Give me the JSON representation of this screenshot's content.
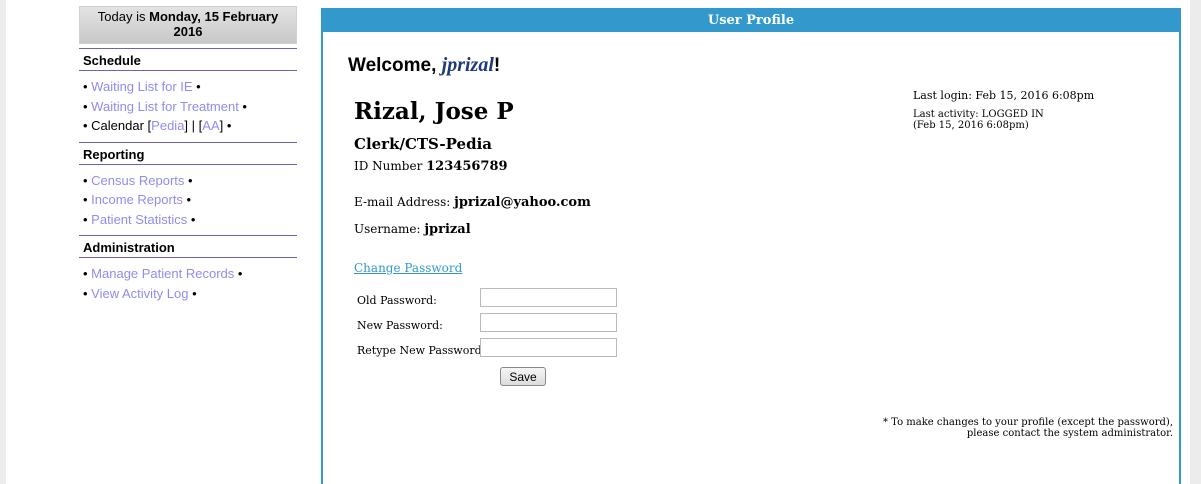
{
  "sidebar": {
    "today_prefix": "Today is ",
    "today_date": "Monday, 15 February 2016",
    "sections": [
      {
        "title": "Schedule",
        "items": [
          {
            "link": "Waiting List for IE",
            "suffix": " •"
          },
          {
            "link": "Waiting List for Treatment",
            "suffix": " •"
          }
        ],
        "calendar": {
          "prefix": "Calendar ",
          "link1": "Pedia",
          "sep": " | ",
          "link2": "AA",
          "suffix": " •"
        }
      },
      {
        "title": "Reporting",
        "items": [
          {
            "link": "Census Reports",
            "suffix": " •"
          },
          {
            "link": "Income Reports",
            "suffix": " •"
          },
          {
            "link": "Patient Statistics",
            "suffix": " •"
          }
        ]
      },
      {
        "title": "Administration",
        "items": [
          {
            "link": "Manage Patient Records",
            "suffix": " •"
          },
          {
            "link": "View Activity Log",
            "suffix": " •"
          }
        ]
      }
    ]
  },
  "panel": {
    "header": "User Profile",
    "welcome_prefix": "Welcome, ",
    "welcome_user": "jprizal",
    "welcome_suffix": "!",
    "full_name": "Rizal, Jose P",
    "role": "Clerk/CTS-Pedia",
    "id_label": "ID Number",
    "id_value": "123456789",
    "email_label": "E-mail Address:",
    "email_value": "jprizal@yahoo.com",
    "username_label": "Username:",
    "username_value": "jprizal",
    "last_login": "Last login: Feb 15, 2016 6:08pm",
    "last_activity_line1": "Last activity: LOGGED IN",
    "last_activity_line2": "(Feb 15, 2016 6:08pm)",
    "change_password_link": "Change Password",
    "password_form": {
      "old_label": "Old Password:",
      "new_label": "New Password:",
      "retype_label": "Retype New Password:",
      "old_value": "",
      "new_value": "",
      "retype_value": "",
      "save_label": "Save"
    },
    "footnote_line1": "* To make changes to your profile (except the password),",
    "footnote_line2": "please contact the system administrator."
  }
}
